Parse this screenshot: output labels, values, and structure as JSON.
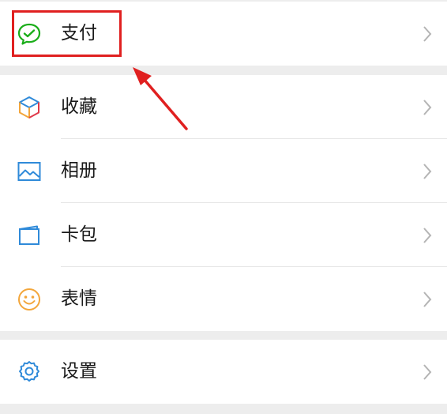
{
  "menu": {
    "pay": {
      "label": "支付",
      "icon": "wechat-pay-icon"
    },
    "items": [
      {
        "label": "收藏",
        "icon": "favorites-cube-icon"
      },
      {
        "label": "相册",
        "icon": "photo-album-icon"
      },
      {
        "label": "卡包",
        "icon": "card-wallet-icon"
      },
      {
        "label": "表情",
        "icon": "smiley-icon"
      }
    ],
    "settings": {
      "label": "设置",
      "icon": "gear-icon"
    }
  },
  "colors": {
    "background": "#ededed",
    "row": "#ffffff",
    "annotation": "#e02020",
    "pay_green": "#1aad19",
    "album_blue": "#2f8ad9",
    "smiley_orange": "#f3a63b"
  }
}
